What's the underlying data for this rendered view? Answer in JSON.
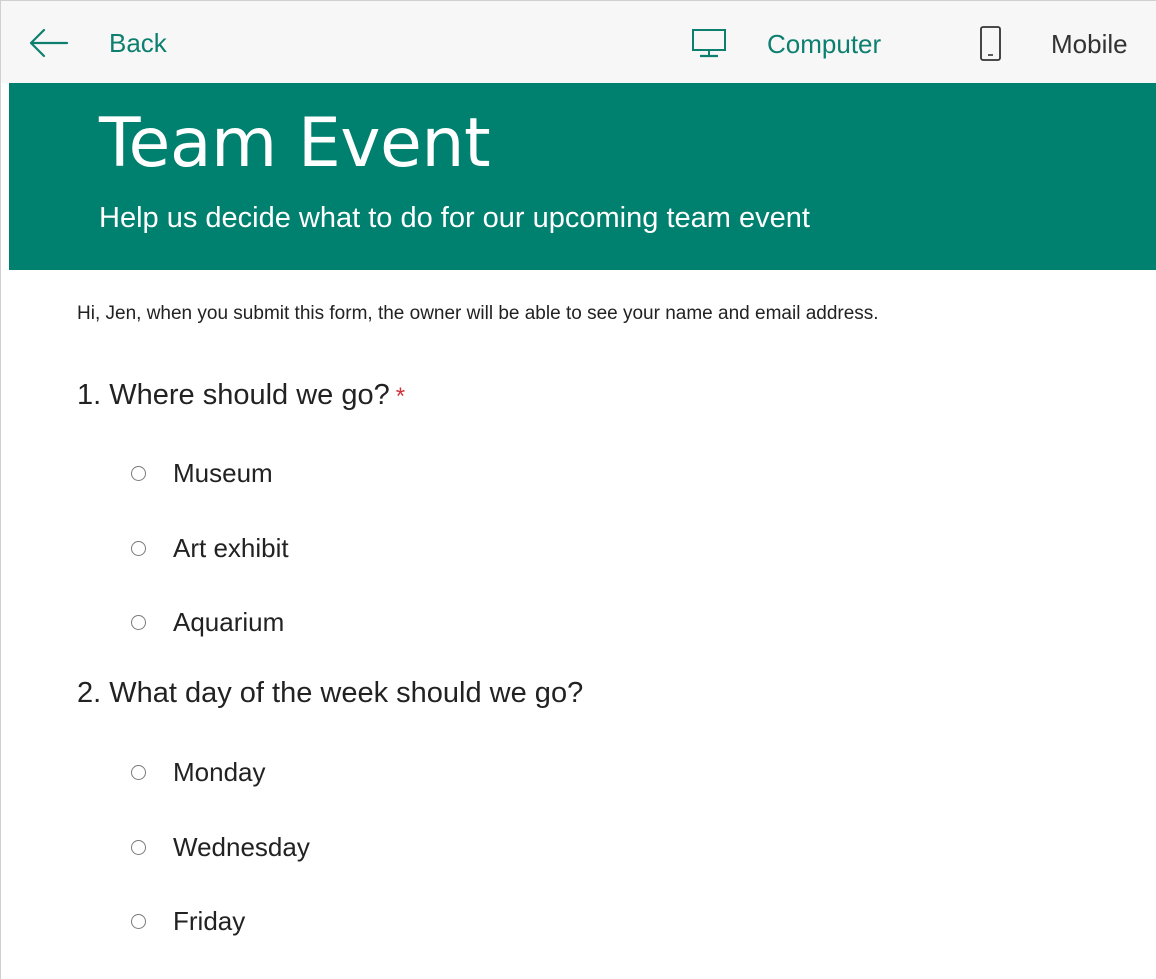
{
  "toolbar": {
    "back_label": "Back",
    "computer_label": "Computer",
    "mobile_label": "Mobile",
    "accent_color": "#0d7f6f",
    "icons": {
      "back": "arrow-left-icon",
      "computer": "monitor-icon",
      "mobile": "phone-icon"
    }
  },
  "form": {
    "title": "Team Event",
    "subtitle": "Help us decide what to do for our upcoming team event",
    "header_color": "#00806f",
    "notice": "Hi, Jen, when you submit this form, the owner will be able to see your name and email address.",
    "questions": [
      {
        "label": "1. Where should we go?",
        "required": true,
        "required_mark": "*",
        "options": [
          "Museum",
          "Art exhibit",
          "Aquarium"
        ],
        "selected": null
      },
      {
        "label": "2. What day of the week should we go?",
        "required": false,
        "options": [
          "Monday",
          "Wednesday",
          "Friday"
        ],
        "selected": null
      }
    ]
  }
}
